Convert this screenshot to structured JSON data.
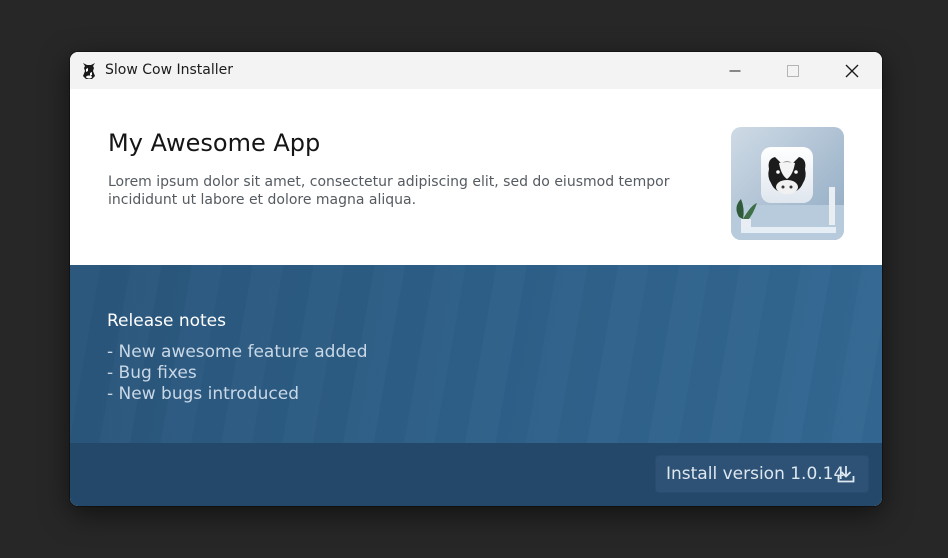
{
  "window": {
    "title": "Slow Cow Installer",
    "controls": {
      "minimize_icon": "minimize-icon",
      "maximize_icon": "maximize-icon",
      "close_icon": "close-icon"
    }
  },
  "header": {
    "app_name": "My Awesome App",
    "description": "Lorem ipsum dolor sit amet, consectetur adipiscing elit, sed do eiusmod tempor incididunt ut labore et dolore magna aliqua.",
    "logo_icon": "cow-app-icon"
  },
  "release_notes": {
    "heading": "Release notes",
    "items": [
      "- New awesome feature added",
      "- Bug fixes",
      "- New bugs introduced"
    ]
  },
  "footer": {
    "install_label": "Install version 1.0.14",
    "install_icon": "download-icon"
  },
  "colors": {
    "notes_background": "#2e6089",
    "footer_background": "#24486a",
    "install_button": "#2e5276",
    "titlebar": "#f3f3f3"
  }
}
